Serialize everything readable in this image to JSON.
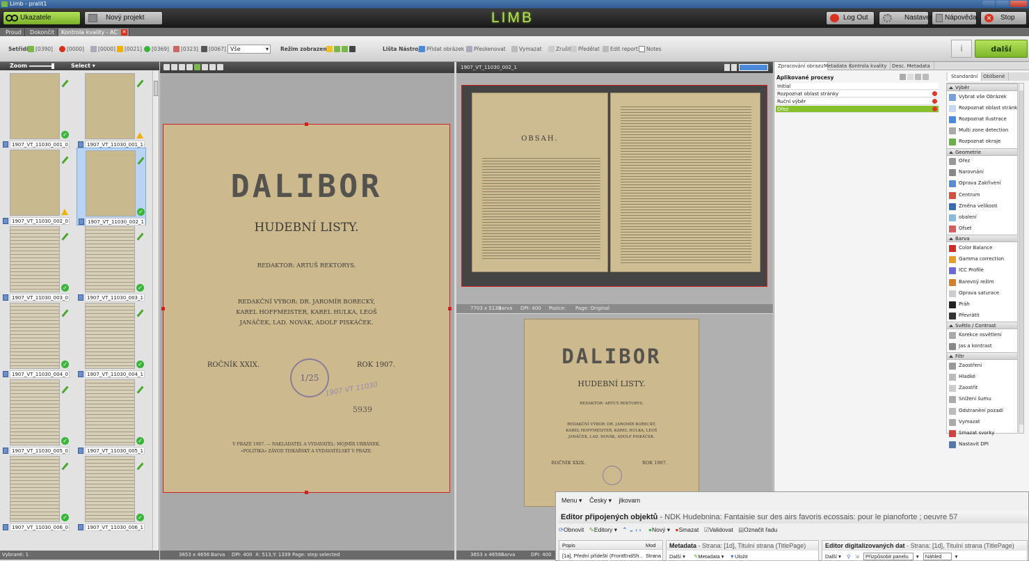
{
  "window": {
    "title": "Limb - pralit1"
  },
  "header": {
    "ukazatele": "Ukazatele",
    "novy_projekt": "Nový projekt",
    "logo": "LIMB",
    "logout": "Log Out",
    "nastaveni": "Nastavení",
    "napoveda": "Nápověda",
    "stop": "Stop"
  },
  "tabs": [
    "Proud",
    "Dokončit",
    "Kontrola kvality - AC"
  ],
  "toolbar": {
    "setridit": "Setřídit",
    "counts": [
      "[0390]",
      "[0000]",
      "[0000]",
      "[0021]",
      "[0369]",
      "[0323]",
      "[0067]"
    ],
    "filter": "Vše",
    "rezim": "Režim zobrazení",
    "lista": "Lišta Nástrojů",
    "pridat": "Přidat obrázek",
    "preskenovat": "Přeskenovat",
    "vymazat": "Vymazat",
    "zrusit": "Zrušit",
    "predelat": "Předělat",
    "editreport": "Edit report",
    "notes": "Notes",
    "info": "i",
    "dalsi": "další"
  },
  "sidebar": {
    "zoom": "Zoom",
    "select": "Select",
    "footer": "Vybrané: 1",
    "thumbs": [
      {
        "label": "1907_VT_11030_001_0",
        "status": "ok"
      },
      {
        "label": "1907_VT_11030_001_1",
        "status": "warn"
      },
      {
        "label": "1907_VT_11030_002_0",
        "status": "warn"
      },
      {
        "label": "1907_VT_11030_002_1",
        "status": "ok"
      },
      {
        "label": "1907_VT_11030_003_0",
        "status": "ok"
      },
      {
        "label": "1907_VT_11030_003_1",
        "status": "ok"
      },
      {
        "label": "1907_VT_11030_004_0",
        "status": "ok"
      },
      {
        "label": "1907_VT_11030_004_1",
        "status": "ok"
      },
      {
        "label": "1907_VT_11030_005_0",
        "status": "ok"
      },
      {
        "label": "1907_VT_11030_005_1",
        "status": "ok"
      },
      {
        "label": "1907_VT_11030_006_0",
        "status": "ok"
      },
      {
        "label": "1907_VT_11030_006_1",
        "status": "ok"
      }
    ]
  },
  "cover": {
    "title": "DALIBOR",
    "subtitle": "HUDEBNÍ LISTY.",
    "redaktor": "REDAKTOR: ARTUŠ REKTORYS.",
    "vybor1": "REDAKČNÍ VÝBOR: DR. JAROMÍR BORECKÝ,",
    "vybor2": "KAREL HOFFMEISTER, KAREL HULKA, LEOŠ",
    "vybor3": "JANÁČEK, LAD. NOVÁK, ADOLF PISKÁČEK.",
    "rocnik": "ROČNÍK XXIX.",
    "rok": "ROK 1907.",
    "stamp": "1/25",
    "handwriting": "1907 VT 11030",
    "number": "5939",
    "imprint1": "V PRAZE 1907. — NAKLADATEL A VYDAVATEL: MOJMÍR URBÁNEK.",
    "imprint2": "»POLITIKA« ZÁVOD TISKAŘSKÝ A VYDAVATELSKÝ V PRAZE."
  },
  "leftpanel": {
    "status": {
      "size": "3653 x 4656",
      "mode": "Barva",
      "dpi": "DPI: 400",
      "coords": "X: 513,Y: 1339",
      "page": "Page: step selected"
    }
  },
  "righttop": {
    "title": "1907_VT_11030_002_1",
    "obsah": "OBSAH.",
    "status": {
      "size": "7703 x 5133",
      "mode": "Barva",
      "dpi": "DPI: 400",
      "pozice": "Pozice:",
      "page": "Page: Original"
    }
  },
  "rightbottom": {
    "status": {
      "size": "3653 x 4656",
      "mode": "Barva",
      "dpi": "DPI: 400"
    }
  },
  "rightpane": {
    "tabs": [
      "Zpracování obrazu",
      "Metadata",
      "Kontrola kvality",
      "Desc. Metadata"
    ],
    "aplikovane": "Aplikované procesy",
    "procesy": [
      "Initial",
      "Rozpoznat oblast stránky",
      "Ruční výběr",
      "Ořez"
    ],
    "subtabs": [
      "Standardní",
      "Oblíbené"
    ],
    "groups": [
      {
        "name": "Výběr",
        "items": [
          "Vybrat vše Obrázek",
          "Rozpoznat oblast stránky",
          "Rozpoznat Ilustrace",
          "Multi zone detection",
          "Rozpoznat okraje"
        ]
      },
      {
        "name": "Geometrie",
        "items": [
          "Ořez",
          "Narovnání",
          "Oprava Zakřivení",
          "Centrum",
          "Změna velikosti",
          "obalení",
          "Ofset"
        ]
      },
      {
        "name": "Barva",
        "items": [
          "Color Balance",
          "Gamma correction",
          "ICC Profile",
          "Barevný režim",
          "Oprava saturace",
          "Práh",
          "Převrátit"
        ]
      },
      {
        "name": "Světlo / Contrast",
        "items": [
          "Korekce osvětlení",
          "Jas a kontrast"
        ]
      },
      {
        "name": "Filtr",
        "items": [
          "Zaostření",
          "Hladké",
          "Zaostřit",
          "Snížení šumu",
          "Odstranění pozadí",
          "Vymazat",
          "Smazat svorky",
          "Nastavit DPI"
        ]
      }
    ]
  },
  "editor": {
    "menu": "Menu",
    "cesky": "Česky",
    "user": "jlkovam",
    "title": "Editor připojených objektů",
    "subtitle": "- NDK Hudebnina: Fantaisie sur des airs favoris ecossais: pour le pianoforte ; oeuvre 57",
    "obnovit": "Obnovit",
    "editory": "Editory",
    "novy": "Nový",
    "smazat": "Smazat",
    "validovat": "Validovat",
    "oznacit": "Označit řadu",
    "col_popis": "Popis",
    "col_mod": "Mod",
    "row_popis": "[1a], Přední přídeští (FrontEndSh…",
    "row_mod": "Strana",
    "metadata_title": "Metadata",
    "metadata_sub": "- Strana: [1d], Titulní strana (TitlePage)",
    "dalsi": "Další",
    "metadata_btn": "Metadata",
    "ulozit": "Uložit",
    "digi_title": "Editor digitalizovaných dat",
    "digi_sub": "- Strana: [1d], Titulní strana (TitlePage)",
    "prizpusobit": "Přizpůsobit panelu",
    "nahled": "Náhled"
  }
}
